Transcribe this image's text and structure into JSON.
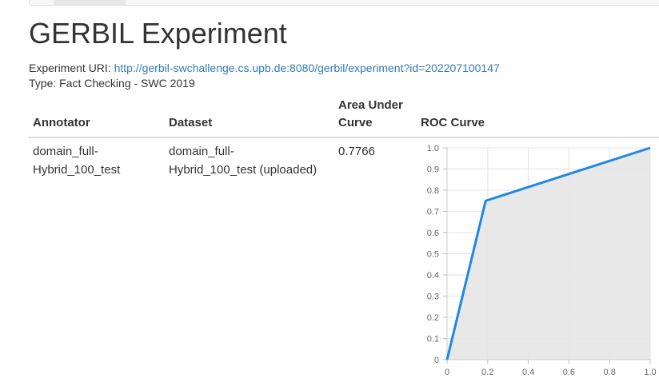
{
  "nav": {
    "active_tab": ""
  },
  "page": {
    "title": "GERBIL Experiment",
    "experiment_uri_label": "Experiment URI:",
    "experiment_uri": "http://gerbil-swchallenge.cs.upb.de:8080/gerbil/experiment?id=202207100147",
    "type_text": "Type: Fact Checking - SWC 2019"
  },
  "table": {
    "headers": {
      "annotator": "Annotator",
      "dataset": "Dataset",
      "auc_line1": "Area Under",
      "auc_line2": "Curve",
      "roc": "ROC Curve"
    },
    "rows": [
      {
        "annotator_line1": "domain_full-",
        "annotator_line2": "Hybrid_100_test",
        "dataset_line1": "domain_full-",
        "dataset_line2": "Hybrid_100_test (uploaded)",
        "auc": "0.7766"
      }
    ]
  },
  "colors": {
    "link": "#337ab7",
    "curve": "#1e88e5",
    "fill": "#e6e6e6"
  },
  "chart_data": {
    "type": "area",
    "title": "",
    "xlabel": "",
    "ylabel": "",
    "xlim": [
      0,
      1
    ],
    "ylim": [
      0,
      1
    ],
    "x_ticks": [
      "0",
      "0.2",
      "0.4",
      "0.6",
      "0.8",
      "1.0"
    ],
    "y_ticks": [
      "0",
      "0.1",
      "0.2",
      "0.3",
      "0.4",
      "0.5",
      "0.6",
      "0.7",
      "0.8",
      "0.9",
      "1.0"
    ],
    "grid": true,
    "series": [
      {
        "x": [
          0,
          0.19,
          1
        ],
        "y": [
          0,
          0.75,
          1
        ]
      }
    ]
  }
}
